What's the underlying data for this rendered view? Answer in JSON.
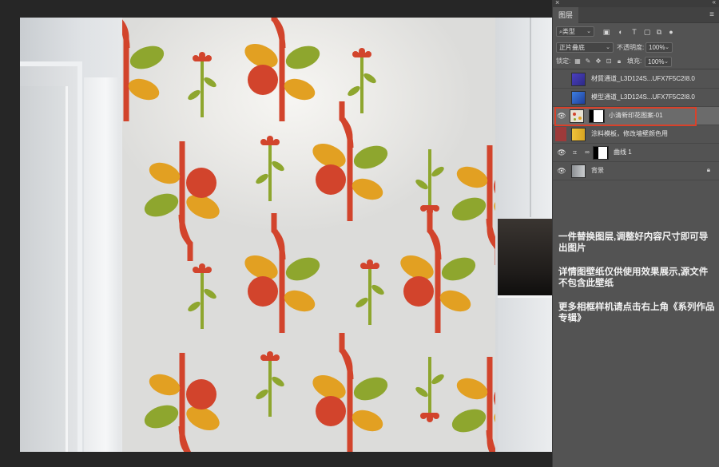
{
  "window": {
    "close_glyph": "×",
    "collapse_glyph": "«"
  },
  "panel": {
    "tab_title": "图层",
    "filter": {
      "label": "类型",
      "icons": [
        "image-filter-icon",
        "adjustment-filter-icon",
        "type-filter-icon",
        "shape-filter-icon",
        "smart-object-filter-icon",
        "filter-toggle-icon"
      ]
    },
    "blend_mode": "正片叠底",
    "opacity": {
      "label": "不透明度:",
      "value": "100%"
    },
    "lock": {
      "label": "锁定:"
    },
    "fill": {
      "label": "填充:",
      "value": "100%"
    },
    "layers": [
      {
        "name": "材質通道_L3D124S...UFX7F5C2I8.0",
        "visible": false,
        "type": "smart-object"
      },
      {
        "name": "模型通道_L3D124S...UFX7F5C2I8.0",
        "visible": false,
        "type": "smart-object"
      },
      {
        "name": "小清新印花图案-01",
        "visible": true,
        "type": "masked",
        "selected": true
      },
      {
        "name": "涂料模板，修改墙壁颜色用",
        "visible": false,
        "type": "fill",
        "hidden_marker": true
      },
      {
        "name": "曲线 1",
        "visible": true,
        "type": "adjustment"
      },
      {
        "name": "背景",
        "visible": true,
        "type": "background",
        "locked": true
      }
    ]
  },
  "notes": [
    "一件替换图层,调整好内容尺寸即可导出图片",
    "详情图壁纸仅供使用效果展示,源文件不包含此壁纸",
    "更多相框样机请点击右上角《系列作品专辑》"
  ],
  "colors": {
    "accent_selection": "#d9412a",
    "panel_bg": "#535353",
    "pattern_red": "#d2442c",
    "pattern_orange": "#e2a022",
    "pattern_green": "#8ea62e"
  }
}
